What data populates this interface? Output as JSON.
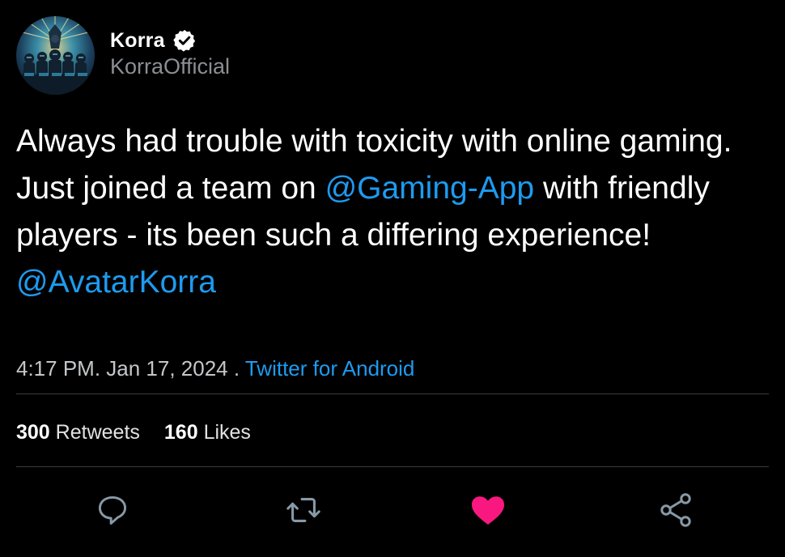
{
  "author": {
    "display_name": "Korra",
    "handle": "KorraOfficial",
    "verified_icon": "verified-badge-icon",
    "avatar_icon": "profile-avatar"
  },
  "tweet": {
    "text_parts": [
      {
        "text": "Always had trouble with toxicity with online gaming. Just joined a team on ",
        "type": "text"
      },
      {
        "text": "@Gaming-App",
        "type": "mention"
      },
      {
        "text": " with friendly players - its been such a differing experience! ",
        "type": "text"
      },
      {
        "text": "@AvatarKorra",
        "type": "mention"
      }
    ]
  },
  "meta": {
    "time": "4:17 PM",
    "time_separator": ".",
    "date": " Jan 17, 2024",
    "source_separator": " . ",
    "source": "Twitter for Android"
  },
  "stats": {
    "retweets_count": "300",
    "retweets_label": "Retweets",
    "likes_count": "160",
    "likes_label": "Likes"
  },
  "actions": [
    {
      "name": "reply",
      "icon": "reply-bubble-icon"
    },
    {
      "name": "retweet",
      "icon": "retweet-icon"
    },
    {
      "name": "like",
      "icon": "heart-filled-icon"
    },
    {
      "name": "share",
      "icon": "share-icon"
    }
  ],
  "colors": {
    "background": "#000000",
    "text": "#ffffff",
    "secondary_text": "#8a8f94",
    "link": "#1d9bf0",
    "like": "#f91880",
    "icon": "#8899a6",
    "divider": "#3a3d40"
  }
}
